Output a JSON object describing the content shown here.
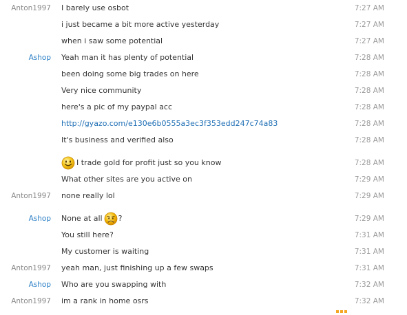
{
  "messages": [
    {
      "sender": "Anton1997",
      "text": "I barely use osbot",
      "time": "7:27 AM",
      "kind": "text"
    },
    {
      "sender": "",
      "text": "i just became a bit more active yesterday",
      "time": "7:27 AM",
      "kind": "text"
    },
    {
      "sender": "",
      "text": "when i saw some potential",
      "time": "7:27 AM",
      "kind": "text"
    },
    {
      "sender": "Ashop",
      "text": "Yeah man it has plenty of potential",
      "time": "7:28 AM",
      "kind": "text"
    },
    {
      "sender": "",
      "text": "been doing some big trades on here",
      "time": "7:28 AM",
      "kind": "text"
    },
    {
      "sender": "",
      "text": "Very nice community",
      "time": "7:28 AM",
      "kind": "text"
    },
    {
      "sender": "",
      "text": "here's a pic of my paypal acc",
      "time": "7:28 AM",
      "kind": "text"
    },
    {
      "sender": "",
      "text": "http://gyazo.com/e130e6b0555a3ec3f353edd247c74a83",
      "time": "7:28 AM",
      "kind": "link"
    },
    {
      "sender": "",
      "text": "It's business and verified also",
      "time": "7:28 AM",
      "kind": "text"
    },
    {
      "sender": "",
      "text": "I trade gold for profit just so you know",
      "time": "7:28 AM",
      "kind": "smile-before"
    },
    {
      "sender": "",
      "text": "What other sites are you active on",
      "time": "7:29 AM",
      "kind": "text"
    },
    {
      "sender": "Anton1997",
      "text": "none really lol",
      "time": "7:29 AM",
      "kind": "text"
    },
    {
      "sender": "Ashop",
      "text": "None at all",
      "text_after": "?",
      "time": "7:29 AM",
      "kind": "frown-after"
    },
    {
      "sender": "",
      "text": "You still here?",
      "time": "7:31 AM",
      "kind": "text"
    },
    {
      "sender": "",
      "text": "My customer is waiting",
      "time": "7:31 AM",
      "kind": "text"
    },
    {
      "sender": "Anton1997",
      "text": "yeah man, just finishing up a few swaps",
      "time": "7:31 AM",
      "kind": "text"
    },
    {
      "sender": "Ashop",
      "text": "Who are you swapping with",
      "time": "7:32 AM",
      "kind": "text"
    },
    {
      "sender": "Anton1997",
      "text": "im a rank in home osrs",
      "time": "7:32 AM",
      "kind": "text"
    }
  ],
  "colors": {
    "anton": "#8a8a8a",
    "ashop": "#2b7fc5",
    "link": "#1f6fb5",
    "time": "#9a9a9a",
    "emoji_yellow": "#f5c518"
  },
  "icons": {
    "smile": "smiley-emoticon-icon",
    "frown": "frowning-emoticon-icon"
  }
}
